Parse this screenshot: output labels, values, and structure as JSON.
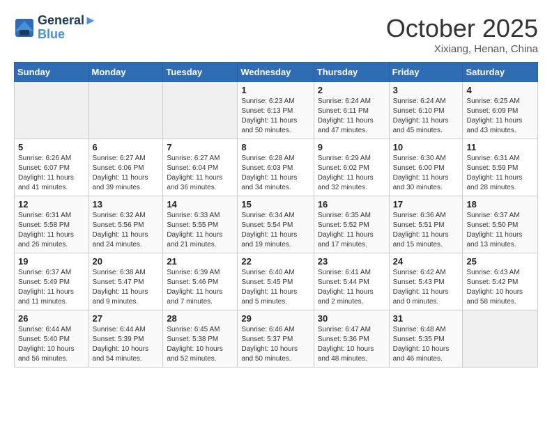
{
  "header": {
    "logo_line1": "General",
    "logo_line2": "Blue",
    "month": "October 2025",
    "location": "Xixiang, Henan, China"
  },
  "weekdays": [
    "Sunday",
    "Monday",
    "Tuesday",
    "Wednesday",
    "Thursday",
    "Friday",
    "Saturday"
  ],
  "weeks": [
    [
      {
        "day": "",
        "info": ""
      },
      {
        "day": "",
        "info": ""
      },
      {
        "day": "",
        "info": ""
      },
      {
        "day": "1",
        "info": "Sunrise: 6:23 AM\nSunset: 6:13 PM\nDaylight: 11 hours\nand 50 minutes."
      },
      {
        "day": "2",
        "info": "Sunrise: 6:24 AM\nSunset: 6:11 PM\nDaylight: 11 hours\nand 47 minutes."
      },
      {
        "day": "3",
        "info": "Sunrise: 6:24 AM\nSunset: 6:10 PM\nDaylight: 11 hours\nand 45 minutes."
      },
      {
        "day": "4",
        "info": "Sunrise: 6:25 AM\nSunset: 6:09 PM\nDaylight: 11 hours\nand 43 minutes."
      }
    ],
    [
      {
        "day": "5",
        "info": "Sunrise: 6:26 AM\nSunset: 6:07 PM\nDaylight: 11 hours\nand 41 minutes."
      },
      {
        "day": "6",
        "info": "Sunrise: 6:27 AM\nSunset: 6:06 PM\nDaylight: 11 hours\nand 39 minutes."
      },
      {
        "day": "7",
        "info": "Sunrise: 6:27 AM\nSunset: 6:04 PM\nDaylight: 11 hours\nand 36 minutes."
      },
      {
        "day": "8",
        "info": "Sunrise: 6:28 AM\nSunset: 6:03 PM\nDaylight: 11 hours\nand 34 minutes."
      },
      {
        "day": "9",
        "info": "Sunrise: 6:29 AM\nSunset: 6:02 PM\nDaylight: 11 hours\nand 32 minutes."
      },
      {
        "day": "10",
        "info": "Sunrise: 6:30 AM\nSunset: 6:00 PM\nDaylight: 11 hours\nand 30 minutes."
      },
      {
        "day": "11",
        "info": "Sunrise: 6:31 AM\nSunset: 5:59 PM\nDaylight: 11 hours\nand 28 minutes."
      }
    ],
    [
      {
        "day": "12",
        "info": "Sunrise: 6:31 AM\nSunset: 5:58 PM\nDaylight: 11 hours\nand 26 minutes."
      },
      {
        "day": "13",
        "info": "Sunrise: 6:32 AM\nSunset: 5:56 PM\nDaylight: 11 hours\nand 24 minutes."
      },
      {
        "day": "14",
        "info": "Sunrise: 6:33 AM\nSunset: 5:55 PM\nDaylight: 11 hours\nand 21 minutes."
      },
      {
        "day": "15",
        "info": "Sunrise: 6:34 AM\nSunset: 5:54 PM\nDaylight: 11 hours\nand 19 minutes."
      },
      {
        "day": "16",
        "info": "Sunrise: 6:35 AM\nSunset: 5:52 PM\nDaylight: 11 hours\nand 17 minutes."
      },
      {
        "day": "17",
        "info": "Sunrise: 6:36 AM\nSunset: 5:51 PM\nDaylight: 11 hours\nand 15 minutes."
      },
      {
        "day": "18",
        "info": "Sunrise: 6:37 AM\nSunset: 5:50 PM\nDaylight: 11 hours\nand 13 minutes."
      }
    ],
    [
      {
        "day": "19",
        "info": "Sunrise: 6:37 AM\nSunset: 5:49 PM\nDaylight: 11 hours\nand 11 minutes."
      },
      {
        "day": "20",
        "info": "Sunrise: 6:38 AM\nSunset: 5:47 PM\nDaylight: 11 hours\nand 9 minutes."
      },
      {
        "day": "21",
        "info": "Sunrise: 6:39 AM\nSunset: 5:46 PM\nDaylight: 11 hours\nand 7 minutes."
      },
      {
        "day": "22",
        "info": "Sunrise: 6:40 AM\nSunset: 5:45 PM\nDaylight: 11 hours\nand 5 minutes."
      },
      {
        "day": "23",
        "info": "Sunrise: 6:41 AM\nSunset: 5:44 PM\nDaylight: 11 hours\nand 2 minutes."
      },
      {
        "day": "24",
        "info": "Sunrise: 6:42 AM\nSunset: 5:43 PM\nDaylight: 11 hours\nand 0 minutes."
      },
      {
        "day": "25",
        "info": "Sunrise: 6:43 AM\nSunset: 5:42 PM\nDaylight: 10 hours\nand 58 minutes."
      }
    ],
    [
      {
        "day": "26",
        "info": "Sunrise: 6:44 AM\nSunset: 5:40 PM\nDaylight: 10 hours\nand 56 minutes."
      },
      {
        "day": "27",
        "info": "Sunrise: 6:44 AM\nSunset: 5:39 PM\nDaylight: 10 hours\nand 54 minutes."
      },
      {
        "day": "28",
        "info": "Sunrise: 6:45 AM\nSunset: 5:38 PM\nDaylight: 10 hours\nand 52 minutes."
      },
      {
        "day": "29",
        "info": "Sunrise: 6:46 AM\nSunset: 5:37 PM\nDaylight: 10 hours\nand 50 minutes."
      },
      {
        "day": "30",
        "info": "Sunrise: 6:47 AM\nSunset: 5:36 PM\nDaylight: 10 hours\nand 48 minutes."
      },
      {
        "day": "31",
        "info": "Sunrise: 6:48 AM\nSunset: 5:35 PM\nDaylight: 10 hours\nand 46 minutes."
      },
      {
        "day": "",
        "info": ""
      }
    ]
  ]
}
